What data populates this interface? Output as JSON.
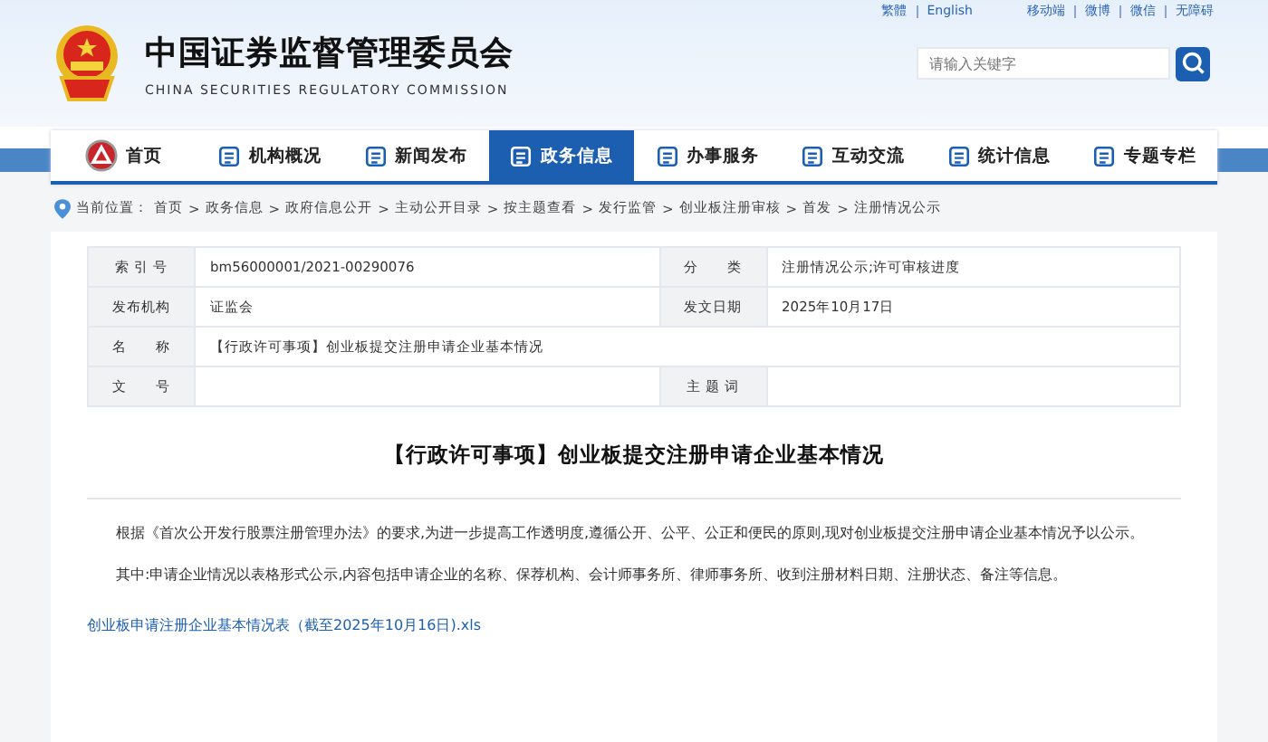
{
  "top_links": {
    "left": [
      "繁體",
      "English"
    ],
    "right": [
      "移动端",
      "微博",
      "微信",
      "无障碍"
    ]
  },
  "header": {
    "title": "中国证券监督管理委员会",
    "subtitle": "CHINA SECURITIES REGULATORY COMMISSION",
    "search": {
      "placeholder": "请输入关键字"
    }
  },
  "nav": [
    {
      "label": "首页",
      "selected": false
    },
    {
      "label": "机构概况",
      "selected": false
    },
    {
      "label": "新闻发布",
      "selected": false
    },
    {
      "label": "政务信息",
      "selected": true
    },
    {
      "label": "办事服务",
      "selected": false
    },
    {
      "label": "互动交流",
      "selected": false
    },
    {
      "label": "统计信息",
      "selected": false
    },
    {
      "label": "专题专栏",
      "selected": false
    }
  ],
  "breadcrumb": {
    "label": "当前位置：",
    "separator": ">",
    "items": [
      "首页",
      "政务信息",
      "政府信息公开",
      "主动公开目录",
      "按主题查看",
      "发行监管",
      "创业板注册审核",
      "首发",
      "注册情况公示"
    ]
  },
  "info_table": {
    "rows": [
      [
        {
          "label": "索 引 号",
          "value": "bm56000001/2021-00290076"
        },
        {
          "label": "分　　类",
          "value": "注册情况公示;许可审核进度"
        }
      ],
      [
        {
          "label": "发布机构",
          "value": "证监会"
        },
        {
          "label": "发文日期",
          "value": "2025年10月17日"
        }
      ],
      [
        {
          "label": "名　　称",
          "value": "【行政许可事项】创业板提交注册申请企业基本情况"
        }
      ],
      [
        {
          "label": "文　　号"
        },
        {
          "label": "主 题 词"
        }
      ]
    ]
  },
  "article": {
    "title": "【行政许可事项】创业板提交注册申请企业基本情况",
    "paragraphs": [
      "根据《首次公开发行股票注册管理办法》的要求,为进一步提高工作透明度,遵循公开、公平、公正和便民的原则,现对创业板提交注册申请企业基本情况予以公示。",
      "其中:申请企业情况以表格形式公示,内容包括申请企业的名称、保荐机构、会计师事务所、律师事务所、收到注册材料日期、注册状态、备注等信息。"
    ],
    "attachment": "创业板申请注册企业基本情况表（截至2025年10月16日).xls"
  }
}
